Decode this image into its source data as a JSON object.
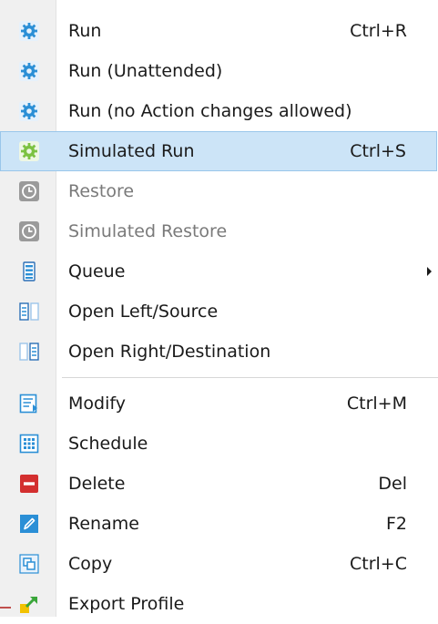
{
  "menu": {
    "items": [
      {
        "label": "Run",
        "shortcut": "Ctrl+R",
        "icon": "gear-icon",
        "disabled": false
      },
      {
        "label": "Run (Unattended)",
        "shortcut": "",
        "icon": "gear-icon",
        "disabled": false
      },
      {
        "label": "Run (no Action changes allowed)",
        "shortcut": "",
        "icon": "gear-icon",
        "disabled": false
      },
      {
        "label": "Simulated Run",
        "shortcut": "Ctrl+S",
        "icon": "gear-green-icon",
        "disabled": false,
        "highlighted": true
      },
      {
        "label": "Restore",
        "shortcut": "",
        "icon": "clock-icon",
        "disabled": true
      },
      {
        "label": "Simulated Restore",
        "shortcut": "",
        "icon": "clock-icon",
        "disabled": true
      },
      {
        "label": "Queue",
        "shortcut": "",
        "icon": "queue-icon",
        "disabled": false,
        "submenu": true
      },
      {
        "label": "Open Left/Source",
        "shortcut": "",
        "icon": "open-left-icon",
        "disabled": false
      },
      {
        "label": "Open Right/Destination",
        "shortcut": "",
        "icon": "open-right-icon",
        "disabled": false
      },
      {
        "label": "Modify",
        "shortcut": "Ctrl+M",
        "icon": "modify-icon",
        "disabled": false
      },
      {
        "label": "Schedule",
        "shortcut": "",
        "icon": "schedule-icon",
        "disabled": false
      },
      {
        "label": "Delete",
        "shortcut": "Del",
        "icon": "delete-icon",
        "disabled": false
      },
      {
        "label": "Rename",
        "shortcut": "F2",
        "icon": "rename-icon",
        "disabled": false
      },
      {
        "label": "Copy",
        "shortcut": "Ctrl+C",
        "icon": "copy-icon",
        "disabled": false
      },
      {
        "label": "Export Profile",
        "shortcut": "",
        "icon": "export-icon",
        "disabled": false
      }
    ]
  },
  "colors": {
    "highlight_bg": "#cce4f7",
    "highlight_border": "#99c6ea",
    "gear_blue": "#2b8fd6",
    "gear_green": "#7cc242",
    "disabled_text": "#7a7a7a",
    "delete_red": "#d32f2f"
  }
}
